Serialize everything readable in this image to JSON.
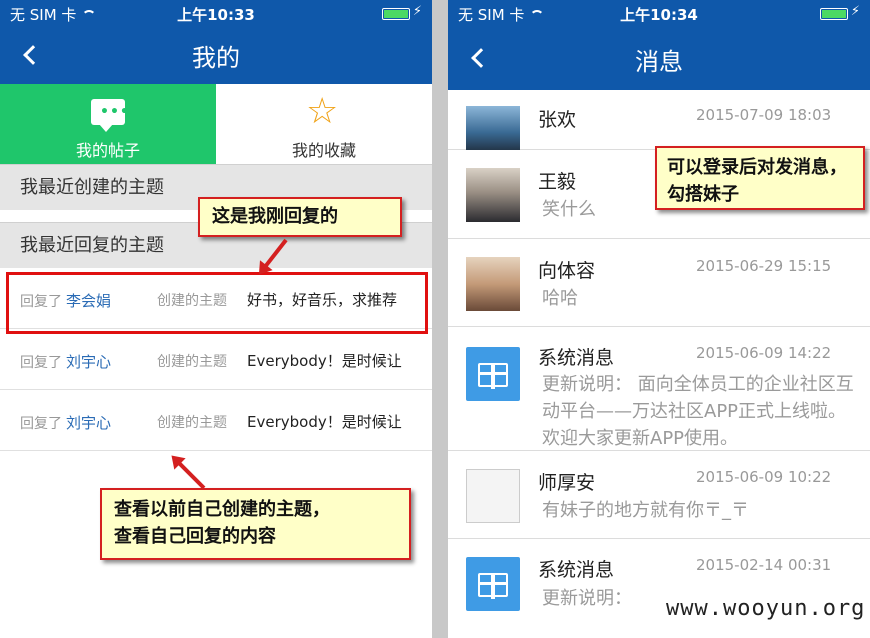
{
  "left": {
    "status": {
      "carrier": "无 SIM 卡",
      "time": "上午10:33"
    },
    "title": "我的",
    "tabs": [
      {
        "label": "我的帖子",
        "icon": "chat-icon"
      },
      {
        "label": "我的收藏",
        "icon": "star-icon"
      }
    ],
    "created_section": "我最近创建的主题",
    "replied_section": "我最近回复的主题",
    "rows": [
      {
        "replied": "回复了",
        "name": "李会娟",
        "created": "创建的主题",
        "topic": "好书，好音乐，求推荐"
      },
      {
        "replied": "回复了",
        "name": "刘宇心",
        "created": "创建的主题",
        "topic": "Everybody！是时候让"
      },
      {
        "replied": "回复了",
        "name": "刘宇心",
        "created": "创建的主题",
        "topic": "Everybody！是时候让"
      }
    ]
  },
  "right": {
    "status": {
      "carrier": "无 SIM 卡",
      "time": "上午10:34"
    },
    "title": "消息",
    "messages": [
      {
        "name": "张欢",
        "time": "2015-07-09 18:03",
        "preview": ""
      },
      {
        "name": "王毅",
        "time": "",
        "preview": "笑什么"
      },
      {
        "name": "向体容",
        "time": "2015-06-29 15:15",
        "preview": "哈哈"
      },
      {
        "name": "系统消息",
        "time": "2015-06-09 14:22",
        "preview": "更新说明： 面向全体员工的企业社区互动平台——万达社区APP正式上线啦。欢迎大家更新APP使用。"
      },
      {
        "name": "师厚安",
        "time": "2015-06-09 10:22",
        "preview": "有妹子的地方就有你〒_〒"
      },
      {
        "name": "系统消息",
        "time": "2015-02-14 00:31",
        "preview": "更新说明："
      }
    ]
  },
  "annotations": {
    "reply_note": "这是我刚回复的",
    "message_note": "可以登录后对发消息，勾搭妹子",
    "bottom_note_line1": "查看以前自己创建的主题，",
    "bottom_note_line2": "查看自己回复的内容"
  },
  "watermark": "www.wooyun.org",
  "colors": {
    "nav": "#0f58aa",
    "tab_active": "#1fc66b",
    "callout_bg": "#ffffc8",
    "callout_border": "#d42020",
    "link": "#2a6bb5"
  }
}
